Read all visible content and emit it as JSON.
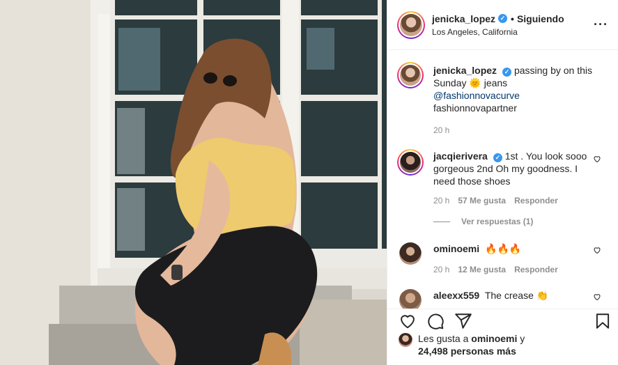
{
  "post": {
    "author": "jenicka_lopez",
    "separator": "•",
    "follow_status": "Siguiendo",
    "location": "Los Angeles, California",
    "more_icon": "more-dots-icon"
  },
  "caption": {
    "author": "jenicka_lopez",
    "text_before": "passing by on this Sunday",
    "emoji": "🌞",
    "text_after": "jeans",
    "mention": "@fashionnovacurve",
    "tag": "fashionnovapartner",
    "time": "20 h"
  },
  "comments": [
    {
      "author": "jacqierivera",
      "verified": true,
      "text": "1st . You look sooo gorgeous 2nd Oh my goodness. I need those shoes",
      "time": "20 h",
      "likes": "57 Me gusta",
      "reply": "Responder",
      "view_replies": "Ver respuestas (1)"
    },
    {
      "author": "ominoemi",
      "verified": false,
      "text": "🔥🔥🔥",
      "time": "20 h",
      "likes": "12 Me gusta",
      "reply": "Responder"
    },
    {
      "author": "aleexx559",
      "verified": false,
      "text": "The crease 👏"
    }
  ],
  "actions": {
    "like": "heart-icon",
    "comment": "comment-icon",
    "share": "share-icon",
    "save": "bookmark-icon"
  },
  "likes": {
    "prefix": "Les gusta a",
    "user": "ominoemi",
    "joiner": "y",
    "count": "24,498 personas más"
  },
  "colors": {
    "verified": "#3897f0",
    "link": "#00376b",
    "muted": "#8e8e8e",
    "text": "#262626"
  }
}
